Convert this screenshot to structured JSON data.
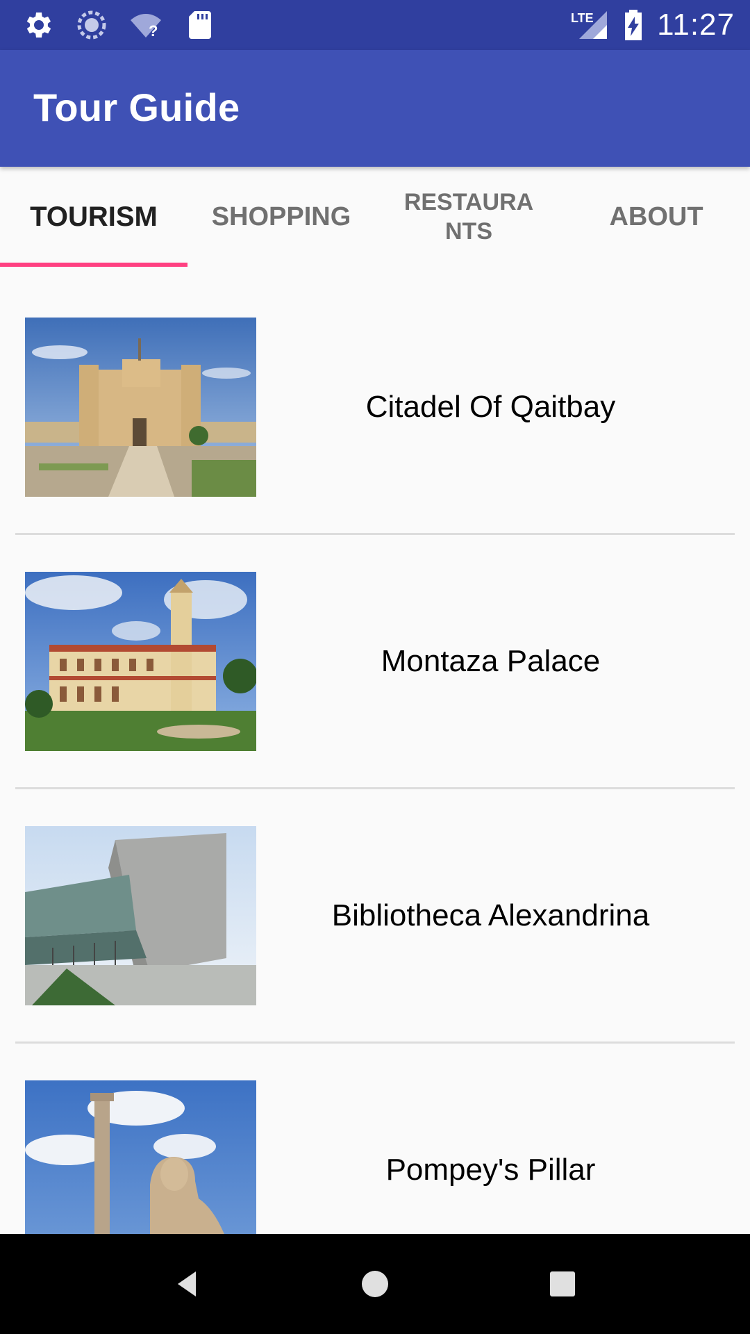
{
  "status_bar": {
    "time": "11:27",
    "network_label": "LTE",
    "icons": [
      "settings-icon",
      "sync-icon",
      "wifi-unknown-icon",
      "sd-card-icon",
      "lte-signal-icon",
      "battery-charging-icon"
    ]
  },
  "app_bar": {
    "title": "Tour Guide",
    "color": "#3f51b5"
  },
  "tabs": {
    "items": [
      {
        "label": "TOURISM",
        "active": true
      },
      {
        "label": "SHOPPING",
        "active": false
      },
      {
        "label_line1": "RESTAURA",
        "label_line2": "NTS",
        "active": false
      },
      {
        "label": "ABOUT",
        "active": false
      }
    ],
    "indicator_color": "#ff4081"
  },
  "places": [
    {
      "name": "Citadel Of Qaitbay",
      "image": "citadel-of-qaitbay-photo"
    },
    {
      "name": "Montaza Palace",
      "image": "montaza-palace-photo"
    },
    {
      "name": "Bibliotheca Alexandrina",
      "image": "bibliotheca-alexandrina-photo"
    },
    {
      "name": "Pompey's Pillar",
      "image": "pompeys-pillar-photo"
    }
  ],
  "nav_bar": {
    "icons": [
      "back-icon",
      "home-icon",
      "recents-icon"
    ]
  }
}
